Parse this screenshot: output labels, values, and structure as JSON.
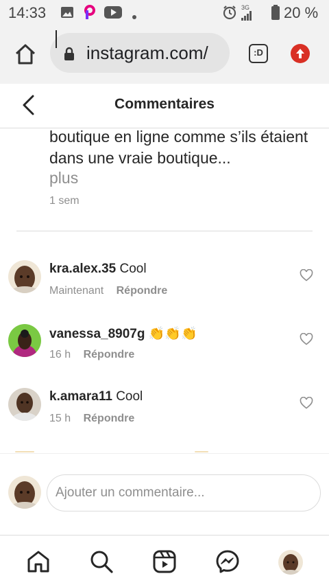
{
  "status_bar": {
    "time": "14:33",
    "network": "3G",
    "battery": "20 %"
  },
  "browser": {
    "url": "instagram.com/",
    "tabs_label": ":D"
  },
  "header": {
    "title": "Commentaires"
  },
  "caption": {
    "text": "boutique en ligne comme s’ils étaient dans une vraie boutique...",
    "more_label": "plus",
    "time": "1 sem"
  },
  "comments": [
    {
      "username": "kra.alex.35",
      "text": "Cool",
      "time": "Maintenant",
      "reply_label": "Répondre",
      "avatar_color": "#6b4a36"
    },
    {
      "username": "vanessa_8907g",
      "text": "👏👏👏",
      "time": "16 h",
      "reply_label": "Répondre",
      "avatar_color": "#7ac943"
    },
    {
      "username": "k.amara11",
      "text": "Cool",
      "time": "15 h",
      "reply_label": "Répondre",
      "avatar_color": "#5a4030"
    }
  ],
  "composer": {
    "placeholder": "Ajouter un commentaire..."
  },
  "bottom_nav": {
    "items": [
      "home-icon",
      "search-icon",
      "reels-icon",
      "messenger-icon",
      "profile-avatar"
    ]
  },
  "colors": {
    "accent_red": "#d93025",
    "secondary_text": "#8e8e8e",
    "primary_text": "#262626"
  }
}
